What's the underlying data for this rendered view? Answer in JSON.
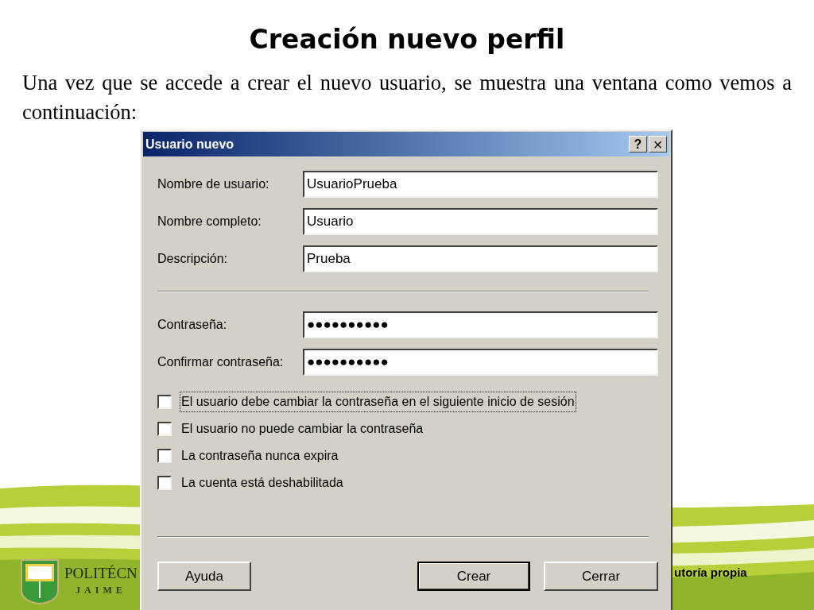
{
  "slide": {
    "title": "Creación nuevo perfil",
    "paragraph": "Una vez que se accede a crear el nuevo usuario, se muestra una ventana como vemos a continuación:",
    "logo_text": "POLITÉCN",
    "logo_subtext": "JAIME",
    "footer_text": "utoría propia"
  },
  "dialog": {
    "title": "Usuario nuevo",
    "help_button": "?",
    "close_button": "×",
    "account_fields": [
      {
        "label": "Nombre de usuario:",
        "value": "UsuarioPrueba"
      },
      {
        "label": "Nombre completo:",
        "value": "Usuario"
      },
      {
        "label": "Descripción:",
        "value": "Prueba"
      }
    ],
    "password_fields": [
      {
        "label": "Contraseña:",
        "value": "●●●●●●●●●●"
      },
      {
        "label": "Confirmar contraseña:",
        "value": "●●●●●●●●●●"
      }
    ],
    "checkboxes": [
      {
        "label": "El usuario debe cambiar la contraseña en el siguiente inicio de sesión",
        "checked": false,
        "focused": true
      },
      {
        "label": "El usuario no puede cambiar la contraseña",
        "checked": false,
        "focused": false
      },
      {
        "label": "La contraseña nunca expira",
        "checked": false,
        "focused": false
      },
      {
        "label": "La cuenta está deshabilitada",
        "checked": false,
        "focused": false
      }
    ],
    "buttons": [
      {
        "label": "Ayuda",
        "default": false
      },
      {
        "label": "Crear",
        "default": true
      },
      {
        "label": "Cerrar",
        "default": false
      }
    ]
  }
}
